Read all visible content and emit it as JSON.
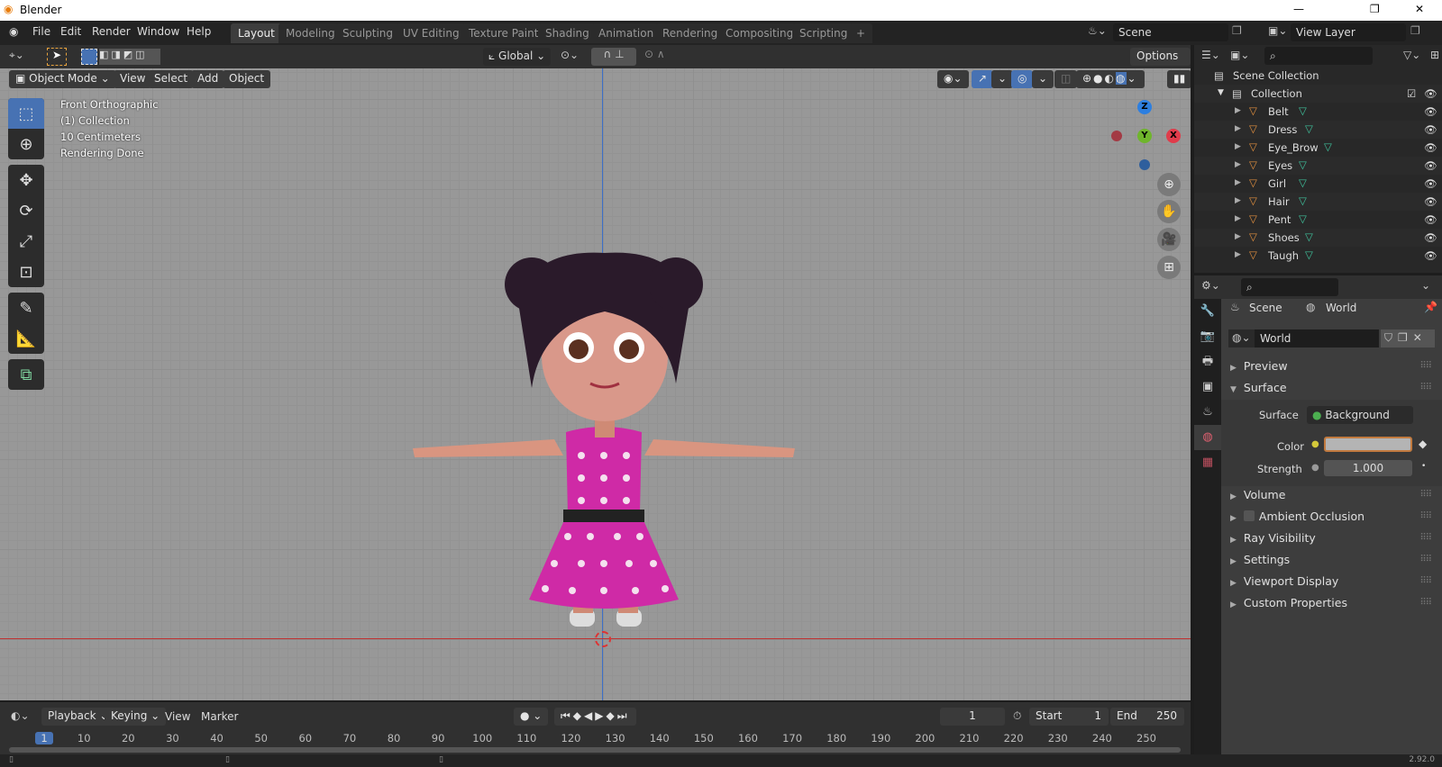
{
  "window": {
    "title": "Blender",
    "minimize": "—",
    "restore": "❐",
    "close": "✕"
  },
  "menu": [
    "File",
    "Edit",
    "Render",
    "Window",
    "Help"
  ],
  "workspaces": [
    "Layout",
    "Modeling",
    "Sculpting",
    "UV Editing",
    "Texture Paint",
    "Shading",
    "Animation",
    "Rendering",
    "Compositing",
    "Scripting",
    "+"
  ],
  "scene": {
    "name": "Scene",
    "view_layer": "View Layer"
  },
  "viewport": {
    "header": {
      "orientation": "Global",
      "options": "Options",
      "mode": "Object Mode",
      "menus": [
        "View",
        "Select",
        "Add",
        "Object"
      ]
    },
    "overlay_text": [
      "Front Orthographic",
      "(1) Collection",
      "10 Centimeters",
      "Rendering Done"
    ],
    "gizmo": {
      "z": "Z",
      "y": "Y",
      "x": "X"
    }
  },
  "outliner": {
    "root": "Scene Collection",
    "collection": "Collection",
    "objects": [
      "Belt",
      "Dress",
      "Eye_Brow",
      "Eyes",
      "Girl",
      "Hair",
      "Pent",
      "Shoes",
      "Taugh"
    ]
  },
  "properties": {
    "breadcrumb": [
      "Scene",
      "World"
    ],
    "world_name": "World",
    "panels_top": [
      "Preview",
      "Surface"
    ],
    "surface": {
      "surface_label": "Surface",
      "surface_value": "Background",
      "color_label": "Color",
      "strength_label": "Strength",
      "strength_value": "1.000",
      "color_value": "#b4b4b4"
    },
    "panels": [
      "Volume",
      "Ambient Occlusion",
      "Ray Visibility",
      "Settings",
      "Viewport Display",
      "Custom Properties"
    ]
  },
  "timeline": {
    "menus": [
      "Playback",
      "Keying",
      "View",
      "Marker"
    ],
    "current_frame": "1",
    "start_label": "Start",
    "start": "1",
    "end_label": "End",
    "end": "250",
    "ticks": [
      1,
      10,
      20,
      30,
      40,
      50,
      60,
      70,
      80,
      90,
      100,
      110,
      120,
      130,
      140,
      150,
      160,
      170,
      180,
      190,
      200,
      210,
      220,
      230,
      240,
      250
    ]
  },
  "status": {
    "version": "2.92.0"
  },
  "colors": {
    "accent": "#4772b3",
    "object_orange": "#e3913f",
    "mesh_green": "#3fc29c"
  }
}
